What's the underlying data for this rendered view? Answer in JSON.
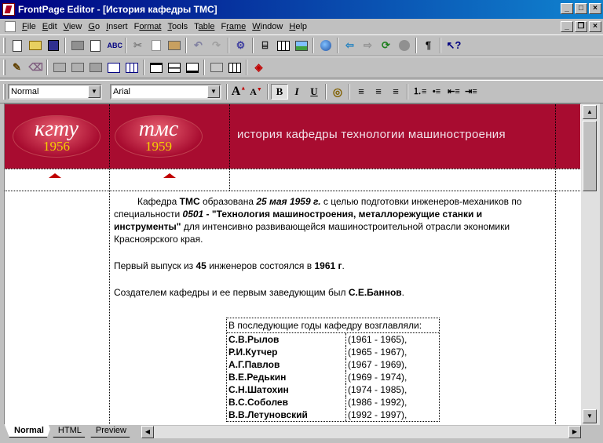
{
  "window": {
    "title": "FrontPage Editor - [История кафедры ТМС]"
  },
  "menu": {
    "items": [
      {
        "key": "F",
        "rest": "ile"
      },
      {
        "key": "E",
        "rest": "dit"
      },
      {
        "key": "V",
        "rest": "iew"
      },
      {
        "key": "G",
        "rest": "o"
      },
      {
        "key": "I",
        "rest": "nsert"
      },
      {
        "key": "F",
        "rest": "ormat",
        "pre": ""
      },
      {
        "key": "T",
        "rest": "ools"
      },
      {
        "key": "T",
        "rest": "able",
        "pre": ""
      },
      {
        "key": "F",
        "rest": "rame",
        "pre": ""
      },
      {
        "key": "W",
        "rest": "indow"
      },
      {
        "key": "H",
        "rest": "elp"
      }
    ]
  },
  "format_toolbar": {
    "style_value": "Normal",
    "font_value": "Arial",
    "bold": "B",
    "italic": "I",
    "underline": "U"
  },
  "banner": {
    "logo1_text": "кгту",
    "logo1_year": "1956",
    "logo2_text": "тмс",
    "logo2_year": "1959",
    "title": "история кафедры технологии машиностроения"
  },
  "content": {
    "p1": {
      "a": "Кафедра ",
      "b": "ТМС",
      "c": " образована ",
      "d": "25 мая 1959 г.",
      "e": " с целью подготовки инженеров-механиков по специальности ",
      "f": "0501",
      "g": " - ",
      "h": "\"Технология машиностроения, металлорежущие станки и инструменты\"",
      "i": " для интенсивно развивающейся машиностроительной отрасли экономики Красноярского края."
    },
    "p2": {
      "a": "Первый выпуск из ",
      "b": "45",
      "c": " инженеров состоялся в ",
      "d": "1961 г",
      "e": "."
    },
    "p3": {
      "a": "Создателем кафедры и ее первым заведующим был ",
      "b": "С.Е.Баннов",
      "c": "."
    }
  },
  "heads": {
    "caption": "В последующие годы кафедру возглавляли:",
    "rows": [
      {
        "name": "С.В.Рылов",
        "years": "(1961 - 1965),"
      },
      {
        "name": "Р.И.Кутчер",
        "years": "(1965 - 1967),"
      },
      {
        "name": "А.Г.Павлов",
        "years": "(1967 - 1969),"
      },
      {
        "name": "В.Е.Редькин",
        "years": "(1969 - 1974),"
      },
      {
        "name": "С.Н.Шатохин",
        "years": "(1974 - 1985),"
      },
      {
        "name": "В.С.Соболев",
        "years": "(1986 - 1992),"
      },
      {
        "name": "В.В.Летуновский",
        "years": "(1992 - 1997),"
      }
    ]
  },
  "tabs": {
    "normal": "Normal",
    "html": "HTML",
    "preview": "Preview"
  }
}
